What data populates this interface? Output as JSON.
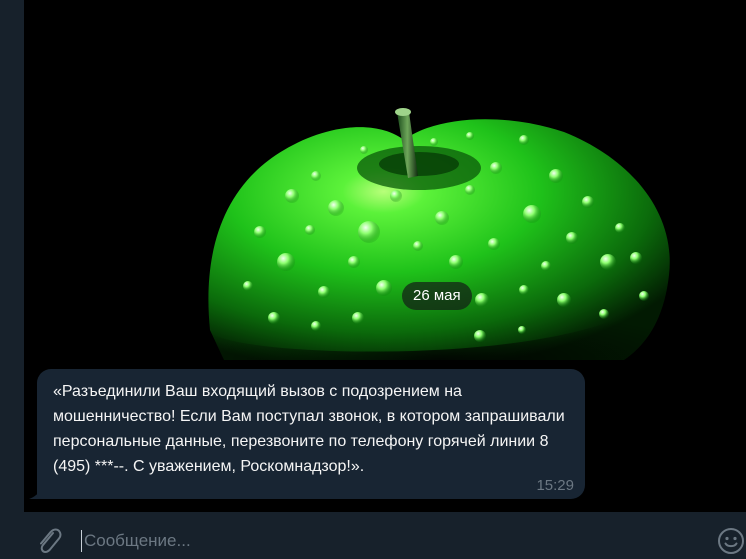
{
  "chat": {
    "date_label": "26 мая",
    "background_image": "green-apple-with-water-drops",
    "message": {
      "text": "«Разъединили Ваш входящий вызов с подозрением на мошенничество! Если Вам поступал звонок, в котором запрашивали персональные данные, перезвоните по телефону горячей линии 8 (495) ***--. С уважением, Роскомнадзор!».",
      "time": "15:29"
    }
  },
  "composer": {
    "placeholder": "Сообщение...",
    "attach_icon": "paperclip-icon",
    "emoji_icon": "emoji-icon"
  },
  "colors": {
    "panel": "#17212b",
    "bubble": "#182533",
    "accent_green": "#2fe03a",
    "time_text": "#6c7883"
  }
}
